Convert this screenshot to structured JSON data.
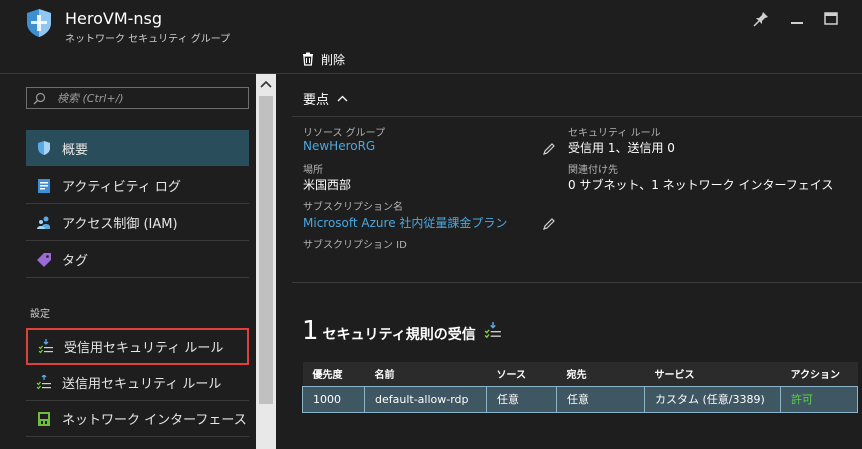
{
  "header": {
    "title": "HeroVM-nsg",
    "subtitle": "ネットワーク セキュリティ グループ"
  },
  "toolbar": {
    "delete_label": "削除"
  },
  "search": {
    "placeholder": "検索 (Ctrl+/)"
  },
  "nav": {
    "items": [
      {
        "label": "概要",
        "icon": "shield-icon",
        "active": true
      },
      {
        "label": "アクティビティ ログ",
        "icon": "activity-log-icon"
      },
      {
        "label": "アクセス制御 (IAM)",
        "icon": "people-icon"
      },
      {
        "label": "タグ",
        "icon": "tag-icon"
      }
    ],
    "section_settings": "設定",
    "settings_items": [
      {
        "label": "受信用セキュリティ ルール",
        "icon": "inbound-rules-icon",
        "highlighted": true
      },
      {
        "label": "送信用セキュリティ ルール",
        "icon": "outbound-rules-icon"
      },
      {
        "label": "ネットワーク インターフェース",
        "icon": "nic-icon"
      }
    ]
  },
  "essentials": {
    "title": "要点",
    "resource_group_label": "リソース グループ",
    "resource_group_value": "NewHeroRG",
    "location_label": "場所",
    "location_value": "米国西部",
    "subscription_name_label": "サブスクリプション名",
    "subscription_name_value": "Microsoft Azure 社内従量課金プラン",
    "subscription_id_label": "サブスクリプション ID",
    "security_rules_label": "セキュリティ ルール",
    "security_rules_value": "受信用 1、送信用 0",
    "associated_label": "関連付け先",
    "associated_value": "0 サブネット、1 ネットワーク インターフェイス"
  },
  "inbound": {
    "count": "1",
    "title": "セキュリティ規則の受信",
    "columns": [
      "優先度",
      "名前",
      "ソース",
      "宛先",
      "サービス",
      "アクション"
    ],
    "rows": [
      {
        "priority": "1000",
        "name": "default-allow-rdp",
        "source": "任意",
        "destination": "任意",
        "service": "カスタム (任意/3389)",
        "action": "許可"
      }
    ]
  },
  "colors": {
    "accent_link": "#4aa8e0",
    "active_nav": "#2a4d5c",
    "highlight_border": "#e0403a",
    "allow_green": "#5ed44a",
    "row_selected": "#3f5663"
  }
}
